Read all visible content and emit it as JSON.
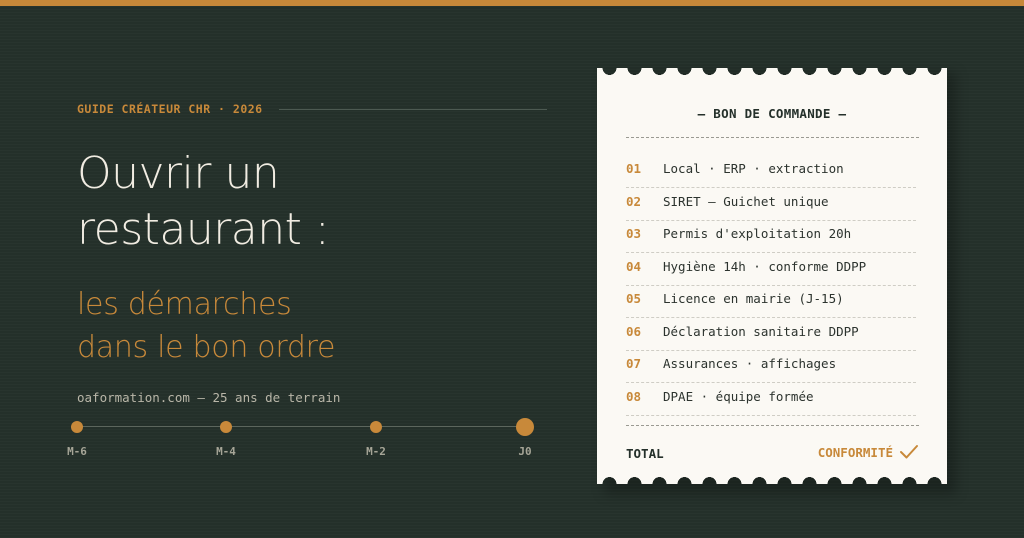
{
  "eyebrow": "GUIDE CRÉATEUR CHR · 2026",
  "title": {
    "line1": "Ouvrir un",
    "line2": "restaurant :"
  },
  "subtitle": {
    "line1": "les démarches",
    "line2": "dans le bon ordre"
  },
  "site": "oaformation.com — 25 ans de terrain",
  "timeline": {
    "labels": [
      "M-6",
      "M-4",
      "M-2",
      "J0"
    ]
  },
  "receipt": {
    "heading": "— BON DE COMMANDE —",
    "items": [
      {
        "num": "01",
        "text": "Local · ERP · extraction"
      },
      {
        "num": "02",
        "text": "SIRET — Guichet unique"
      },
      {
        "num": "03",
        "text": "Permis d'exploitation 20h"
      },
      {
        "num": "04",
        "text": "Hygiène 14h · conforme DDPP"
      },
      {
        "num": "05",
        "text": "Licence en mairie (J-15)"
      },
      {
        "num": "06",
        "text": "Déclaration sanitaire DDPP"
      },
      {
        "num": "07",
        "text": "Assurances · affichages"
      },
      {
        "num": "08",
        "text": "DPAE · équipe formée"
      }
    ],
    "total_label": "TOTAL",
    "status_label": "CONFORMITÉ",
    "status_icon": "checkmark-icon"
  },
  "colors": {
    "background": "#24302a",
    "accent": "#c8893a",
    "text_light": "#f1ece2",
    "paper": "#fbf9f4"
  }
}
